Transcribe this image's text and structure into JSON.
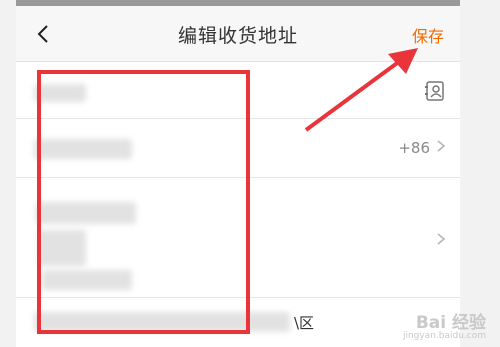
{
  "header": {
    "back_icon": "chevron-left-icon",
    "title": "编辑收货地址",
    "save_label": "保存"
  },
  "form": {
    "name_row": {
      "contact_icon": "contact-book-icon"
    },
    "phone_row": {
      "country_code": "+86",
      "chevron_icon": "chevron-right-icon"
    },
    "region_row": {
      "chevron_icon": "chevron-right-icon"
    },
    "detail_row": {
      "district_suffix": "\\区"
    }
  },
  "annotation": {
    "highlight_color": "#e8343a",
    "arrow_color": "#e8343a"
  },
  "watermark": {
    "brand": "Bai 经验",
    "url": "jingyan.baidu.com"
  },
  "colors": {
    "accent": "#f56a00"
  }
}
